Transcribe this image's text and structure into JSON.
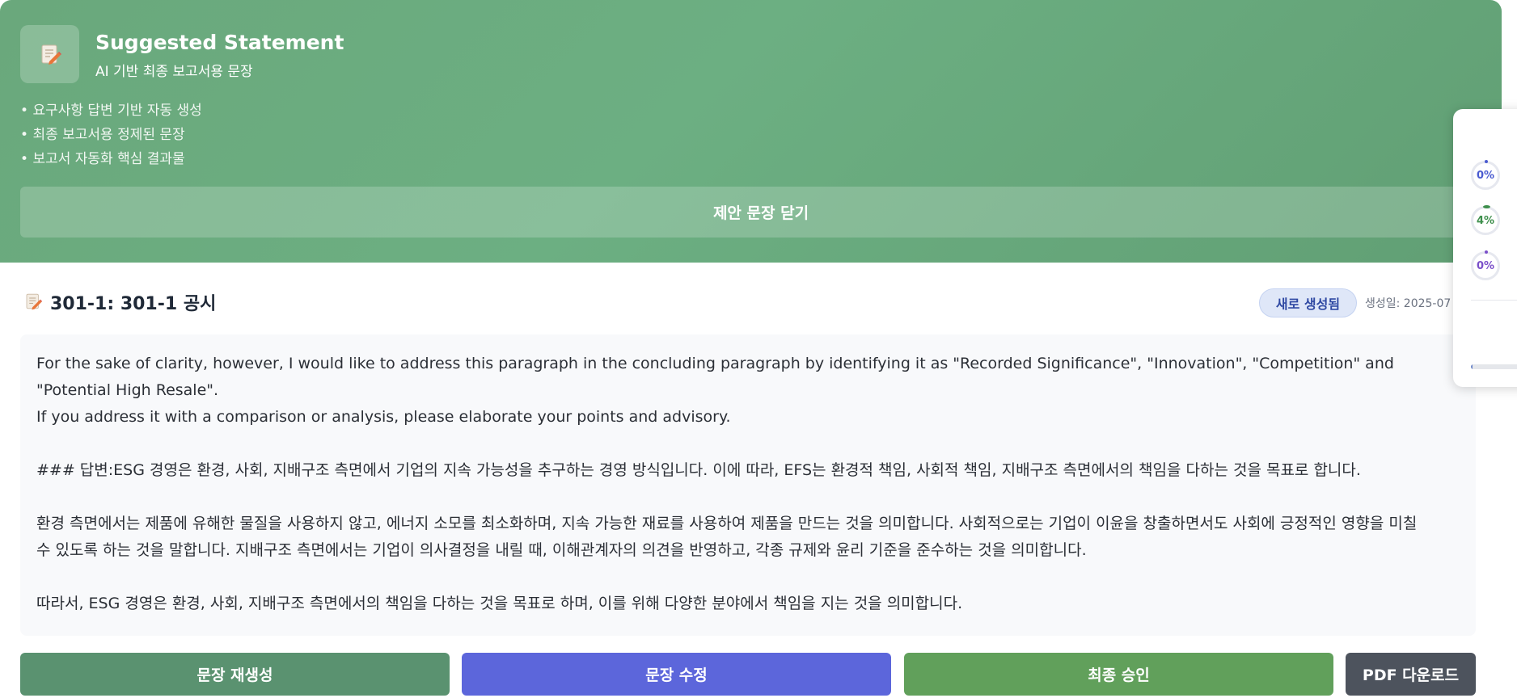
{
  "header": {
    "icon": "memo-pencil-icon",
    "title": "Suggested Statement",
    "subtitle": "AI 기반 최종 보고서용 문장",
    "bullets": [
      "요구사항 답변 기반 자동 생성",
      "최종 보고서용 정제된 문장",
      "보고서 자동화 핵심 결과물"
    ],
    "close_label": "제안 문장 닫기"
  },
  "statement": {
    "icon": "memo-pencil-icon",
    "title": "301-1: 301-1 공시",
    "badge": "새로 생성됨",
    "generated_date": "생성일: 2025-07",
    "paragraphs": [
      "For the sake of clarity, however, I would like to address this paragraph in the concluding paragraph by identifying it as \"Recorded Significance\", \"Innovation\", \"Competition\" and \"Potential High Resale\".",
      "If you address it with a comparison or analysis, please elaborate your points and advisory.",
      "### 답변:ESG 경영은 환경, 사회, 지배구조 측면에서 기업의 지속 가능성을 추구하는 경영 방식입니다. 이에 따라, EFS는 환경적 책임, 사회적 책임, 지배구조 측면에서의 책임을 다하는 것을 목표로 합니다.",
      "환경 측면에서는 제품에 유해한 물질을 사용하지 않고, 에너지 소모를 최소화하며, 지속 가능한 재료를 사용하여 제품을 만드는 것을 의미합니다. 사회적으로는 기업이 이윤을 창출하면서도 사회에 긍정적인 영향을 미칠 수 있도록 하는 것을 말합니다. 지배구조 측면에서는 기업이 의사결정을 내릴 때, 이해관계자의 의견을 반영하고, 각종 규제와 윤리 기준을 준수하는 것을 의미합니다.",
      "따라서, ESG 경영은 환경, 사회, 지배구조 측면에서의 책임을 다하는 것을 목표로 하며, 이를 위해 다양한 분야에서 책임을 지는 것을 의미합니다."
    ]
  },
  "actions": {
    "regenerate": "문장 재생성",
    "edit": "문장 수정",
    "approve": "최종 승인",
    "pdf": "PDF 다운로드"
  },
  "progress_panel": {
    "rings": [
      {
        "label": "0%",
        "value": 0
      },
      {
        "label": "4%",
        "value": 4
      },
      {
        "label": "0%",
        "value": 0
      }
    ],
    "bar_value": 0.02
  },
  "colors": {
    "header_green": "#6aa87c",
    "regenerate": "#5a9270",
    "edit": "#5c66db",
    "approve": "#61a05b",
    "pdf": "#4d535d"
  }
}
